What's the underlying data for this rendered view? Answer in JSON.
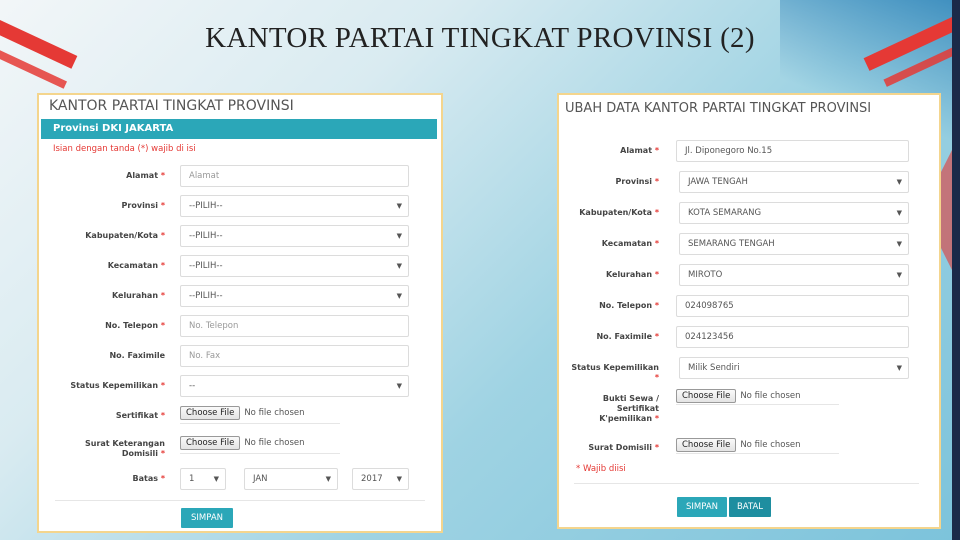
{
  "slide": {
    "title": "KANTOR PARTAI TINGKAT PROVINSI (2)"
  },
  "left_form": {
    "title": "KANTOR PARTAI TINGKAT PROVINSI",
    "section_bar": "Provinsi DKI JAKARTA",
    "note": "Isian dengan tanda (*) wajib di isi",
    "required_mark": "*",
    "fields": {
      "alamat": {
        "label": "Alamat",
        "placeholder": "Alamat"
      },
      "provinsi": {
        "label": "Provinsi",
        "value": "--PILIH--"
      },
      "kabupaten": {
        "label": "Kabupaten/Kota",
        "value": "--PILIH--"
      },
      "kecamatan": {
        "label": "Kecamatan",
        "value": "--PILIH--"
      },
      "kelurahan": {
        "label": "Kelurahan",
        "value": "--PILIH--"
      },
      "telepon": {
        "label": "No. Telepon",
        "placeholder": "No. Telepon"
      },
      "faximile": {
        "label": "No. Faximile",
        "placeholder": "No. Fax"
      },
      "status": {
        "label": "Status Kepemilikan",
        "value": "--"
      },
      "sertifikat": {
        "label": "Sertifikat",
        "button": "Choose File",
        "file_text": "No file chosen"
      },
      "surat": {
        "label_line1": "Surat Keterangan",
        "label_line2": "Domisili",
        "button": "Choose File",
        "file_text": "No file chosen"
      },
      "batas": {
        "label": "Batas",
        "day": "1",
        "month": "JAN",
        "year": "2017"
      }
    },
    "submit": "SIMPAN"
  },
  "right_form": {
    "title": "UBAH DATA KANTOR PARTAI TINGKAT PROVINSI",
    "required_mark": "*",
    "fields": {
      "alamat": {
        "label": "Alamat",
        "value": "Jl. Diponegoro No.15"
      },
      "provinsi": {
        "label": "Provinsi",
        "value": "JAWA TENGAH"
      },
      "kabupaten": {
        "label": "Kabupaten/Kota",
        "value": "KOTA SEMARANG"
      },
      "kecamatan": {
        "label": "Kecamatan",
        "value": "SEMARANG TENGAH"
      },
      "kelurahan": {
        "label": "Kelurahan",
        "value": "MIROTO"
      },
      "telepon": {
        "label": "No. Telepon",
        "value": "024098765"
      },
      "faximile": {
        "label": "No. Faximile",
        "value": "024123456"
      },
      "status": {
        "label": "Status Kepemilikan",
        "value": "Milik Sendiri"
      },
      "bukti": {
        "label_line1": "Bukti Sewa /",
        "label_line2": "Sertifikat",
        "label_line3": "K'pemilikan",
        "button": "Choose File",
        "file_text": "No file chosen"
      },
      "domisili": {
        "label": "Surat Domisili",
        "button": "Choose File",
        "file_text": "No file chosen"
      }
    },
    "note": "* Wajib diisi",
    "save": "SIMPAN",
    "cancel": "BATAL"
  }
}
